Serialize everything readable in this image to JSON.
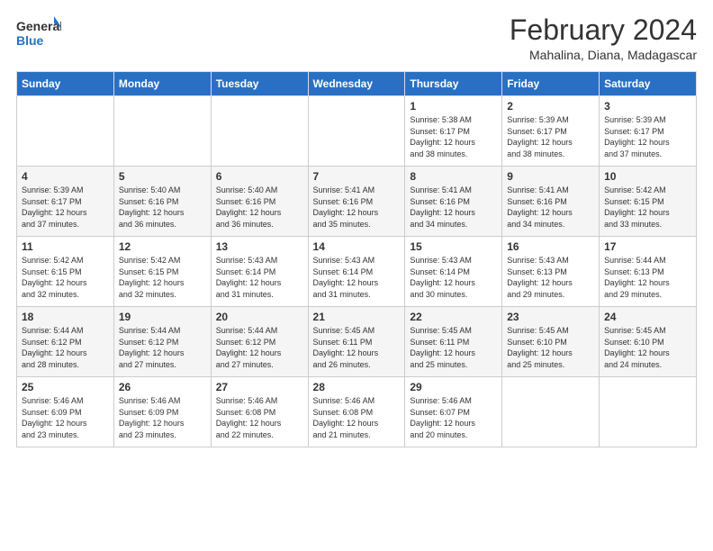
{
  "logo": {
    "line1": "General",
    "line2": "Blue"
  },
  "header": {
    "title": "February 2024",
    "subtitle": "Mahalina, Diana, Madagascar"
  },
  "weekdays": [
    "Sunday",
    "Monday",
    "Tuesday",
    "Wednesday",
    "Thursday",
    "Friday",
    "Saturday"
  ],
  "weeks": [
    [
      {
        "day": "",
        "info": ""
      },
      {
        "day": "",
        "info": ""
      },
      {
        "day": "",
        "info": ""
      },
      {
        "day": "",
        "info": ""
      },
      {
        "day": "1",
        "info": "Sunrise: 5:38 AM\nSunset: 6:17 PM\nDaylight: 12 hours\nand 38 minutes."
      },
      {
        "day": "2",
        "info": "Sunrise: 5:39 AM\nSunset: 6:17 PM\nDaylight: 12 hours\nand 38 minutes."
      },
      {
        "day": "3",
        "info": "Sunrise: 5:39 AM\nSunset: 6:17 PM\nDaylight: 12 hours\nand 37 minutes."
      }
    ],
    [
      {
        "day": "4",
        "info": "Sunrise: 5:39 AM\nSunset: 6:17 PM\nDaylight: 12 hours\nand 37 minutes."
      },
      {
        "day": "5",
        "info": "Sunrise: 5:40 AM\nSunset: 6:16 PM\nDaylight: 12 hours\nand 36 minutes."
      },
      {
        "day": "6",
        "info": "Sunrise: 5:40 AM\nSunset: 6:16 PM\nDaylight: 12 hours\nand 36 minutes."
      },
      {
        "day": "7",
        "info": "Sunrise: 5:41 AM\nSunset: 6:16 PM\nDaylight: 12 hours\nand 35 minutes."
      },
      {
        "day": "8",
        "info": "Sunrise: 5:41 AM\nSunset: 6:16 PM\nDaylight: 12 hours\nand 34 minutes."
      },
      {
        "day": "9",
        "info": "Sunrise: 5:41 AM\nSunset: 6:16 PM\nDaylight: 12 hours\nand 34 minutes."
      },
      {
        "day": "10",
        "info": "Sunrise: 5:42 AM\nSunset: 6:15 PM\nDaylight: 12 hours\nand 33 minutes."
      }
    ],
    [
      {
        "day": "11",
        "info": "Sunrise: 5:42 AM\nSunset: 6:15 PM\nDaylight: 12 hours\nand 32 minutes."
      },
      {
        "day": "12",
        "info": "Sunrise: 5:42 AM\nSunset: 6:15 PM\nDaylight: 12 hours\nand 32 minutes."
      },
      {
        "day": "13",
        "info": "Sunrise: 5:43 AM\nSunset: 6:14 PM\nDaylight: 12 hours\nand 31 minutes."
      },
      {
        "day": "14",
        "info": "Sunrise: 5:43 AM\nSunset: 6:14 PM\nDaylight: 12 hours\nand 31 minutes."
      },
      {
        "day": "15",
        "info": "Sunrise: 5:43 AM\nSunset: 6:14 PM\nDaylight: 12 hours\nand 30 minutes."
      },
      {
        "day": "16",
        "info": "Sunrise: 5:43 AM\nSunset: 6:13 PM\nDaylight: 12 hours\nand 29 minutes."
      },
      {
        "day": "17",
        "info": "Sunrise: 5:44 AM\nSunset: 6:13 PM\nDaylight: 12 hours\nand 29 minutes."
      }
    ],
    [
      {
        "day": "18",
        "info": "Sunrise: 5:44 AM\nSunset: 6:12 PM\nDaylight: 12 hours\nand 28 minutes."
      },
      {
        "day": "19",
        "info": "Sunrise: 5:44 AM\nSunset: 6:12 PM\nDaylight: 12 hours\nand 27 minutes."
      },
      {
        "day": "20",
        "info": "Sunrise: 5:44 AM\nSunset: 6:12 PM\nDaylight: 12 hours\nand 27 minutes."
      },
      {
        "day": "21",
        "info": "Sunrise: 5:45 AM\nSunset: 6:11 PM\nDaylight: 12 hours\nand 26 minutes."
      },
      {
        "day": "22",
        "info": "Sunrise: 5:45 AM\nSunset: 6:11 PM\nDaylight: 12 hours\nand 25 minutes."
      },
      {
        "day": "23",
        "info": "Sunrise: 5:45 AM\nSunset: 6:10 PM\nDaylight: 12 hours\nand 25 minutes."
      },
      {
        "day": "24",
        "info": "Sunrise: 5:45 AM\nSunset: 6:10 PM\nDaylight: 12 hours\nand 24 minutes."
      }
    ],
    [
      {
        "day": "25",
        "info": "Sunrise: 5:46 AM\nSunset: 6:09 PM\nDaylight: 12 hours\nand 23 minutes."
      },
      {
        "day": "26",
        "info": "Sunrise: 5:46 AM\nSunset: 6:09 PM\nDaylight: 12 hours\nand 23 minutes."
      },
      {
        "day": "27",
        "info": "Sunrise: 5:46 AM\nSunset: 6:08 PM\nDaylight: 12 hours\nand 22 minutes."
      },
      {
        "day": "28",
        "info": "Sunrise: 5:46 AM\nSunset: 6:08 PM\nDaylight: 12 hours\nand 21 minutes."
      },
      {
        "day": "29",
        "info": "Sunrise: 5:46 AM\nSunset: 6:07 PM\nDaylight: 12 hours\nand 20 minutes."
      },
      {
        "day": "",
        "info": ""
      },
      {
        "day": "",
        "info": ""
      }
    ]
  ]
}
